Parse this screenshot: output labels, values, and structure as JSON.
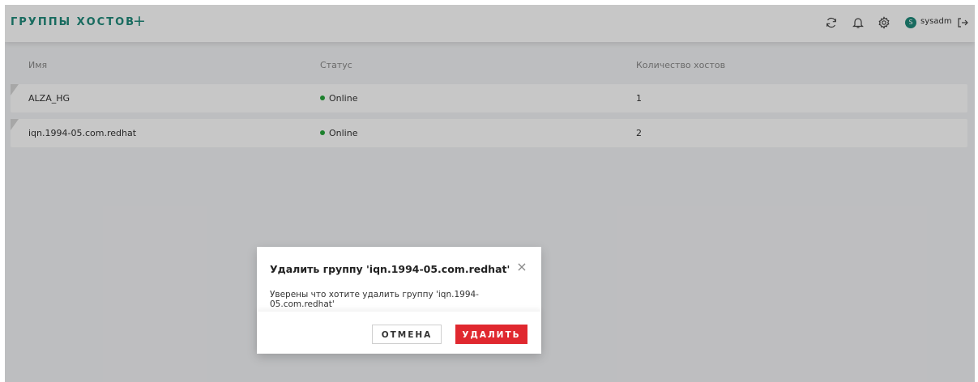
{
  "header": {
    "title": "ГРУППЫ ХОСТОВ",
    "add_symbol": "+",
    "icons": [
      "refresh-icon",
      "bell-icon",
      "gear-icon",
      "logout-icon"
    ],
    "user": {
      "initial": "S",
      "name": "sysadm"
    }
  },
  "table": {
    "columns": [
      "Имя",
      "Статус",
      "Количество хостов"
    ],
    "rows": [
      {
        "name": "ALZA_HG",
        "status": "Online",
        "count": "1"
      },
      {
        "name": "iqn.1994-05.com.redhat",
        "status": "Online",
        "count": "2"
      }
    ]
  },
  "modal": {
    "title": "Удалить группу 'iqn.1994-05.com.redhat'",
    "close_symbol": "×",
    "text": "Уверены что хотите удалить группу 'iqn.1994-05.com.redhat'",
    "cancel_label": "ОТМЕНА",
    "delete_label": "УДАЛИТЬ"
  },
  "colors": {
    "accent": "#1f8a7a",
    "online": "#26a53a",
    "danger": "#e0282f"
  }
}
